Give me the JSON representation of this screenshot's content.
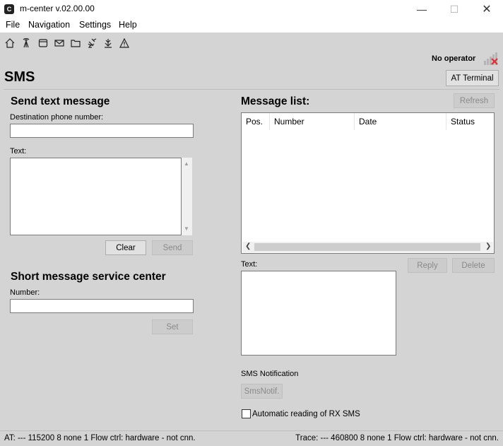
{
  "window": {
    "title": "m-center v.02.00.00",
    "app_icon_glyph": "C",
    "minimize": "—",
    "maximize": "☐",
    "close": "✕"
  },
  "menu": [
    "File",
    "Navigation",
    "Settings",
    "Help"
  ],
  "toolbar": {
    "icons": [
      "home-icon",
      "antenna-icon",
      "window-icon",
      "mail-icon",
      "folder-icon",
      "satellite-icon",
      "download-icon",
      "warning-icon"
    ]
  },
  "operator": {
    "text": "No operator",
    "signal_color": "#e03030"
  },
  "page": {
    "title": "SMS",
    "at_terminal": "AT Terminal"
  },
  "send": {
    "title": "Send  text message",
    "dest_label": "Destination phone number:",
    "dest_value": "",
    "text_label": "Text:",
    "text_value": "",
    "clear": "Clear",
    "send": "Send"
  },
  "smsc": {
    "title": "Short message service center",
    "number_label": "Number:",
    "number_value": "",
    "set": "Set"
  },
  "messages": {
    "title": "Message list:",
    "refresh": "Refresh",
    "columns": [
      "Pos.",
      "Number",
      "Date",
      "Status"
    ],
    "text_label": "Text:",
    "reply": "Reply",
    "delete": "Delete"
  },
  "notification": {
    "label": "SMS Notification",
    "button": "SmsNotif.",
    "auto_read": "Automatic reading of RX SMS",
    "auto_read_checked": false
  },
  "status": {
    "at": "AT: --- 115200 8 none 1 Flow ctrl: hardware - not cnn.",
    "trace": "Trace: --- 460800 8 none 1 Flow ctrl: hardware - not cnn."
  }
}
